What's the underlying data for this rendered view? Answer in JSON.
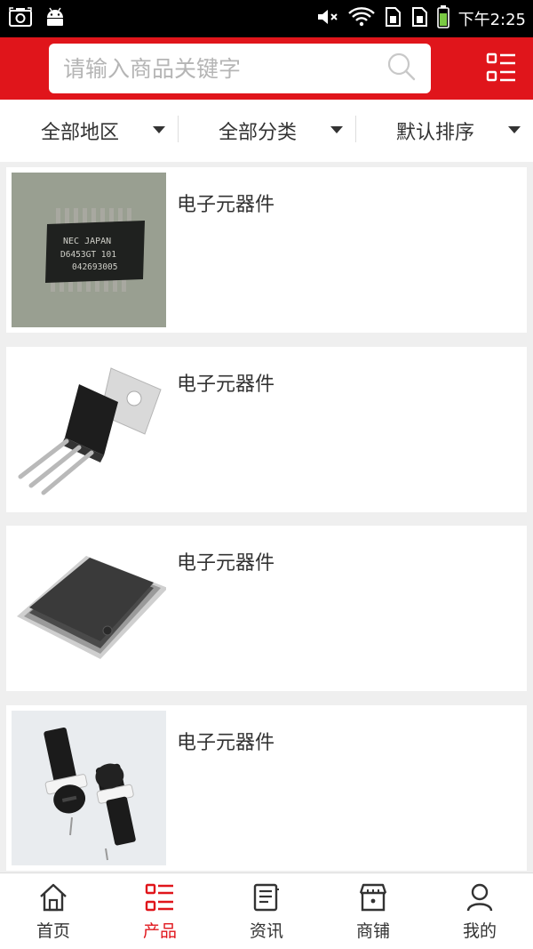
{
  "status_bar": {
    "time": "下午2:25",
    "icons": [
      "screenshot-icon",
      "android-icon",
      "mute-icon",
      "wifi-icon",
      "sim1-icon",
      "sim2-icon",
      "battery-icon"
    ]
  },
  "header": {
    "search_placeholder": "请输入商品关键字",
    "accent_color": "#e0151b"
  },
  "filters": [
    {
      "label": "全部地区"
    },
    {
      "label": "全部分类"
    },
    {
      "label": "默认排序"
    }
  ],
  "products": [
    {
      "title": "电子元器件",
      "image": "soic-chip"
    },
    {
      "title": "电子元器件",
      "image": "to220-transistor"
    },
    {
      "title": "电子元器件",
      "image": "qfp-chip"
    },
    {
      "title": "电子元器件",
      "image": "fuse-holder"
    }
  ],
  "chip_markings": [
    "NEC JAPAN",
    "D6453GT  101",
    "042693005"
  ],
  "bottom_nav": [
    {
      "label": "首页",
      "icon": "home-icon",
      "active": false
    },
    {
      "label": "产品",
      "icon": "product-list-icon",
      "active": true
    },
    {
      "label": "资讯",
      "icon": "news-icon",
      "active": false
    },
    {
      "label": "商铺",
      "icon": "shop-icon",
      "active": false
    },
    {
      "label": "我的",
      "icon": "user-icon",
      "active": false
    }
  ]
}
